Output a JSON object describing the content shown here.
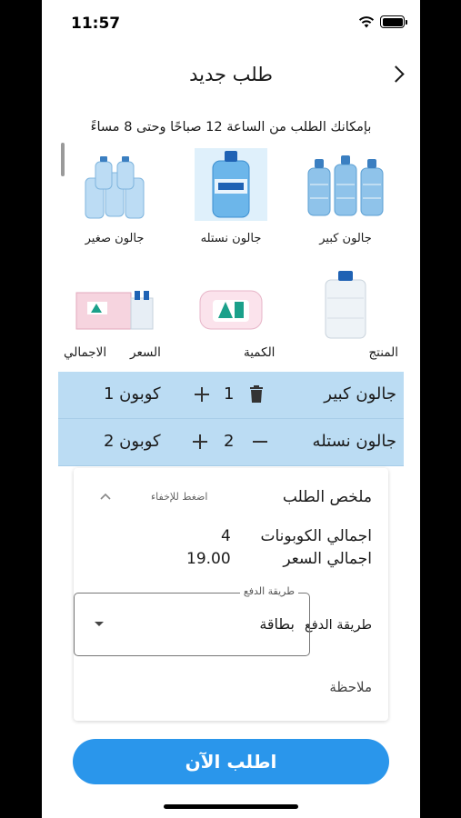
{
  "status_bar": {
    "time": "11:57"
  },
  "header": {
    "title": "طلب جديد"
  },
  "notice": "بإمكانك الطلب من الساعة 12 صباحًا وحتى 8 مساءً",
  "products": [
    {
      "label": "جالون كبير"
    },
    {
      "label": "جالون نستله"
    },
    {
      "label": "جالون صغير"
    },
    {
      "label": ""
    },
    {
      "label": ""
    },
    {
      "label": ""
    }
  ],
  "columns": {
    "product": "المنتج",
    "quantity": "الكمية",
    "price": "السعر",
    "total": "الاجمالي"
  },
  "cart": [
    {
      "name": "جالون كبير",
      "qty": "1",
      "coupons": "كوبون 1"
    },
    {
      "name": "جالون نستله",
      "qty": "2",
      "coupons": "كوبون 2"
    }
  ],
  "summary": {
    "title": "ملخص الطلب",
    "hide_hint": "اضغط للإخفاء",
    "total_coupons_label": "اجمالي الكوبونات",
    "total_coupons_value": "4",
    "total_price_label": "اجمالي السعر",
    "total_price_value": "19.00",
    "payment_label": "طريقة الدفع",
    "payment_legend": "طريقة الدفع",
    "payment_value": "بطاقة",
    "note_label": "ملاحظة"
  },
  "order_button": "اطلب الآن",
  "colors": {
    "accent": "#2a96eb",
    "cart_row": "#bbdcf3"
  }
}
